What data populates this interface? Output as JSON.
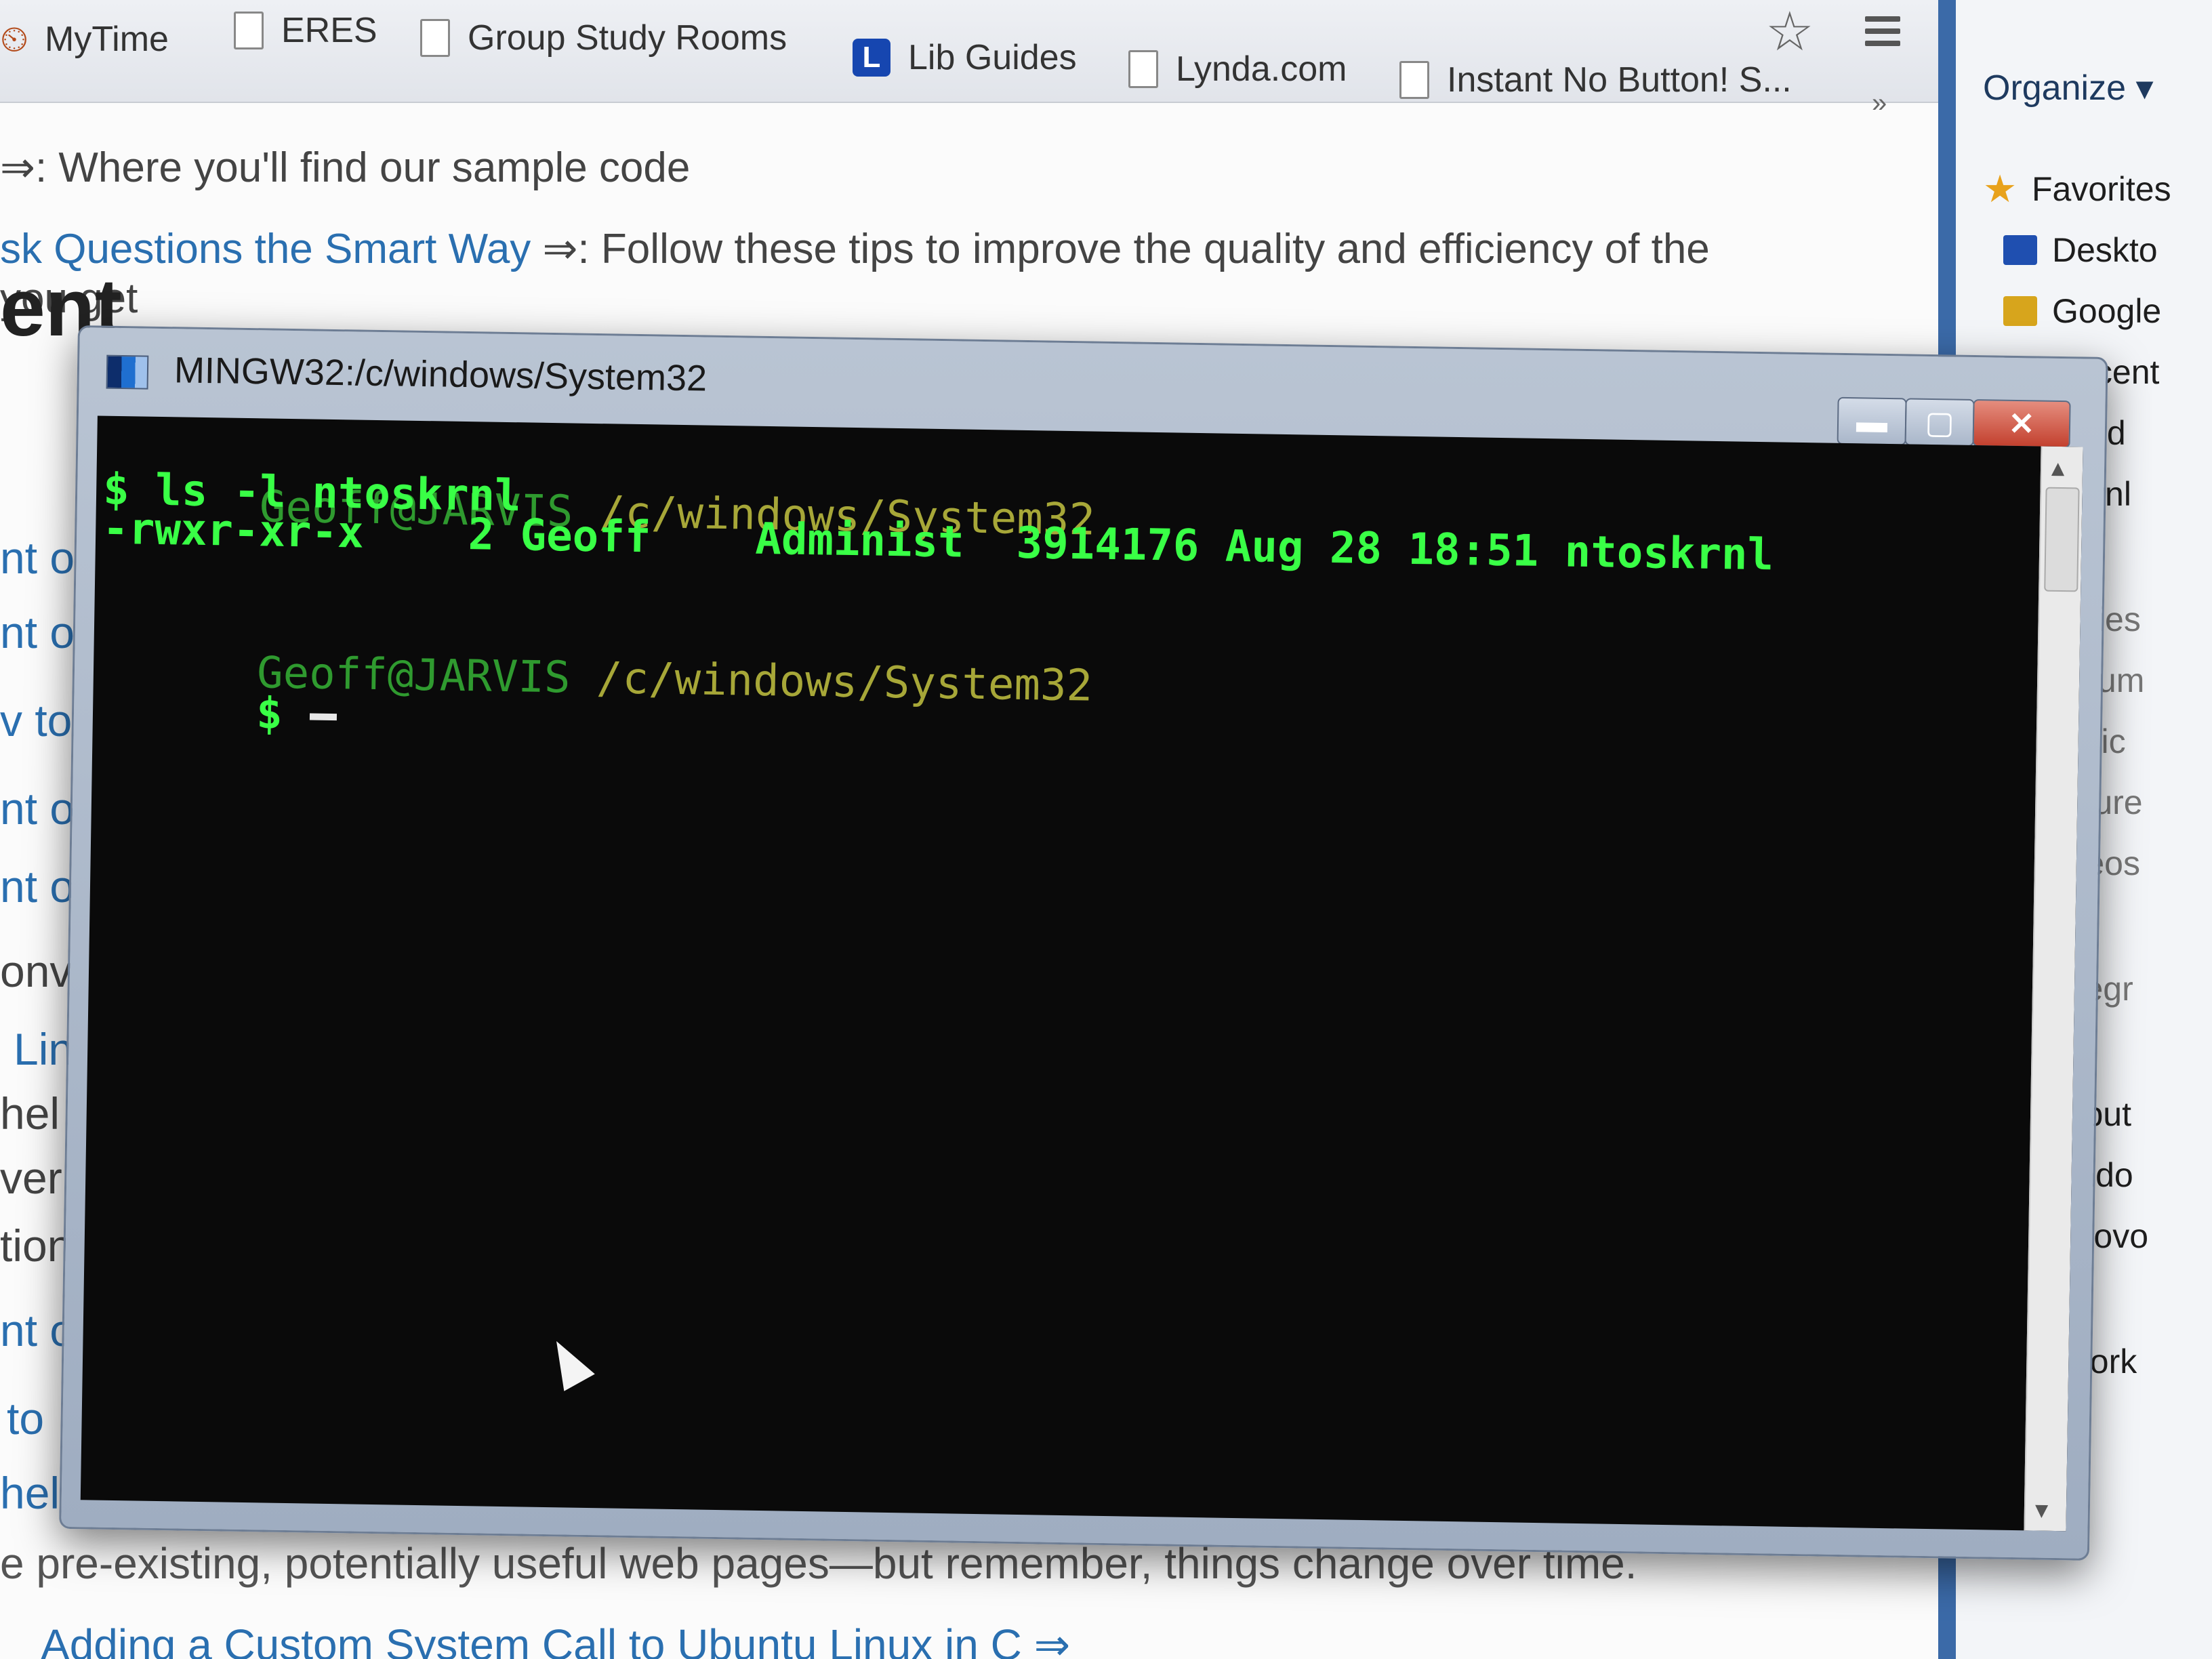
{
  "bookmarks": {
    "items": [
      {
        "label": "MyTime",
        "icon": "clock-icon"
      },
      {
        "label": "ERES",
        "icon": "page-icon"
      },
      {
        "label": "Group Study Rooms",
        "icon": "page-icon"
      },
      {
        "label": "Lib Guides",
        "icon": "lib-guides-icon",
        "badge": "L"
      },
      {
        "label": "Lynda.com",
        "icon": "page-icon"
      },
      {
        "label": "Instant No Button! S...",
        "icon": "page-icon"
      }
    ],
    "overflow": "»",
    "star": "☆"
  },
  "page": {
    "line1_prefix": "⇒",
    "line1": ": Where you'll find our sample code",
    "link2": "sk Questions the Smart Way",
    "link2_arrow": "⇒",
    "line2_rest": ": Follow these tips to improve the quality and efficiency of the",
    "line3": "you get",
    "heading": "ent",
    "stubs": [
      "nt o",
      "nt o",
      "v to",
      "nt o",
      "nt o",
      "onv",
      "Lin",
      "hel",
      "ver",
      "tion",
      "nt o",
      "to",
      "hel"
    ],
    "bottom_line": "e pre-existing, potentially useful web pages—but remember, things change over time.",
    "bottom_link": "Adding a Custom System Call to Ubuntu Linux in C ⇒"
  },
  "explorer": {
    "organize": "Organize ▾",
    "nav": [
      {
        "label": "Favorites",
        "icon": "star-icon",
        "color": "#e8a21c"
      },
      {
        "label": "Deskto",
        "icon": "desktop-icon",
        "color": "#1f4fb0"
      },
      {
        "label": "Google",
        "icon": "google-drive-icon",
        "color": "#d7a51c"
      },
      {
        "label": "Recent",
        "icon": "recent-icon",
        "color": "#7a8aa0"
      },
      {
        "label": "Cloud",
        "icon": "",
        "color": ""
      },
      {
        "label": "Downl",
        "icon": "",
        "color": ""
      },
      {
        "label": "braries",
        "icon": "",
        "color": ""
      },
      {
        "label": "Docum",
        "icon": "",
        "color": ""
      },
      {
        "label": "Music",
        "icon": "",
        "color": ""
      },
      {
        "label": "Picture",
        "icon": "",
        "color": ""
      },
      {
        "label": "Videos",
        "icon": "",
        "color": ""
      },
      {
        "label": "omegr",
        "icon": "",
        "color": ""
      },
      {
        "label": "omput",
        "icon": "",
        "color": ""
      },
      {
        "label": "Windo",
        "icon": "",
        "color": ""
      },
      {
        "label": "Lenovo",
        "icon": "",
        "color": ""
      },
      {
        "label": "etwork",
        "icon": "",
        "color": ""
      }
    ]
  },
  "terminal": {
    "title": "MINGW32:/c/windows/System32",
    "minimize": "▬",
    "maximize": "▢",
    "close": "✕",
    "lines": [
      {
        "user": "Geoff@JARVIS",
        "path": "/c/windows/System32"
      },
      {
        "command": "$ ls -l ntoskrnl"
      },
      {
        "output": "-rwxr-xr-x    2 Geoff    Administ  3914176 Aug 28 18:51 ntoskrnl"
      },
      {
        "user": "Geoff@JARVIS",
        "path": "/c/windows/System32"
      },
      {
        "prompt_char": "$"
      }
    ]
  }
}
